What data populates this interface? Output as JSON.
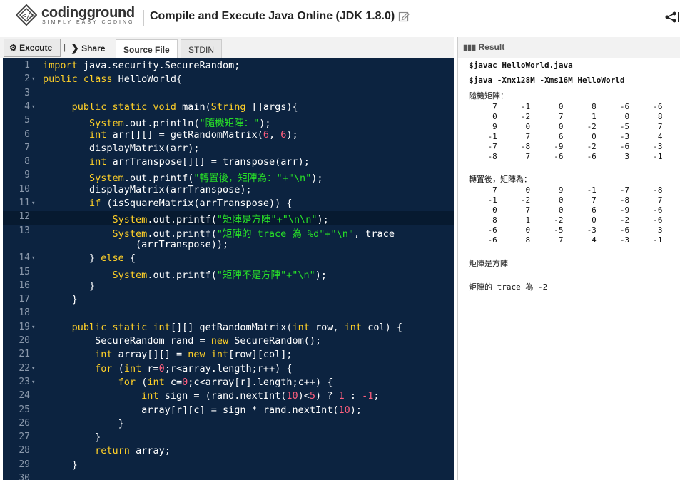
{
  "header": {
    "brand": "codingground",
    "brand_sub": "SIMPLY EASY CODING",
    "title": "Compile and Execute Java Online (JDK 1.8.0)"
  },
  "toolbar": {
    "execute_label": "Execute",
    "share_label": "Share",
    "tabs": [
      "Source File",
      "STDIN"
    ]
  },
  "editor": {
    "lines": [
      {
        "n": "1",
        "fold": false,
        "html": "<span class='k'>import</span> java.security.SecureRandom;"
      },
      {
        "n": "2",
        "fold": true,
        "html": "<span class='k'>public class</span> HelloWorld{"
      },
      {
        "n": "3",
        "fold": false,
        "html": ""
      },
      {
        "n": "4",
        "fold": true,
        "html": "     <span class='k'>public static void</span> main(<span class='k'>String</span> []args){"
      },
      {
        "n": "5",
        "fold": false,
        "html": "        <span class='k'>System</span>.out.println(<span class='s'>\"隨機矩陣：\"</span>);"
      },
      {
        "n": "6",
        "fold": false,
        "html": "        <span class='k'>int</span> arr[][] = getRandomMatrix(<span class='n'>6</span>, <span class='n'>6</span>);"
      },
      {
        "n": "7",
        "fold": false,
        "html": "        displayMatrix(arr);"
      },
      {
        "n": "8",
        "fold": false,
        "html": "        <span class='k'>int</span> arrTranspose[][] = transpose(arr);"
      },
      {
        "n": "9",
        "fold": false,
        "html": "        <span class='k'>System</span>.out.printf(<span class='s'>\"轉置後，矩陣為：\"+\"\\n\"</span>);"
      },
      {
        "n": "10",
        "fold": false,
        "html": "        displayMatrix(arrTranspose);"
      },
      {
        "n": "11",
        "fold": true,
        "html": "        <span class='k'>if</span> (isSquareMatrix(arrTranspose)) {"
      },
      {
        "n": "12",
        "fold": false,
        "html": "            <span class='k'>System</span>.out.printf(<span class='s'>\"矩陣是方陣\"+\"\\n\\n\"</span>);"
      },
      {
        "n": "13",
        "fold": false,
        "html": "            <span class='k'>System</span>.out.printf(<span class='s'>\"矩陣的 trace 為 %d\"+\"\\n\"</span>, trace"
      },
      {
        "n": "",
        "fold": false,
        "html": "                (arrTranspose));"
      },
      {
        "n": "14",
        "fold": true,
        "html": "        } <span class='k'>else</span> {"
      },
      {
        "n": "15",
        "fold": false,
        "html": "            <span class='k'>System</span>.out.printf(<span class='s'>\"矩陣不是方陣\"+\"\\n\"</span>);"
      },
      {
        "n": "16",
        "fold": false,
        "html": "        }"
      },
      {
        "n": "17",
        "fold": false,
        "html": "     }"
      },
      {
        "n": "18",
        "fold": false,
        "html": ""
      },
      {
        "n": "19",
        "fold": true,
        "html": "     <span class='k'>public static int</span>[][] getRandomMatrix(<span class='k'>int</span> row, <span class='k'>int</span> col) {"
      },
      {
        "n": "20",
        "fold": false,
        "html": "         SecureRandom rand = <span class='k'>new</span> SecureRandom();"
      },
      {
        "n": "21",
        "fold": false,
        "html": "         <span class='k'>int</span> array[][] = <span class='k'>new int</span>[row][col];"
      },
      {
        "n": "22",
        "fold": true,
        "html": "         <span class='k'>for</span> (<span class='k'>int</span> r=<span class='n'>0</span>;r&lt;array.length;r++) {"
      },
      {
        "n": "23",
        "fold": true,
        "html": "             <span class='k'>for</span> (<span class='k'>int</span> c=<span class='n'>0</span>;c&lt;array[r].length;c++) {"
      },
      {
        "n": "24",
        "fold": false,
        "html": "                 <span class='k'>int</span> sign = (rand.nextInt(<span class='n'>10</span>)&lt;<span class='n'>5</span>) ? <span class='n'>1</span> : <span class='n'>-1</span>;"
      },
      {
        "n": "25",
        "fold": false,
        "html": "                 array[r][c] = sign * rand.nextInt(<span class='n'>10</span>);"
      },
      {
        "n": "26",
        "fold": false,
        "html": "             }"
      },
      {
        "n": "27",
        "fold": false,
        "html": "         }"
      },
      {
        "n": "28",
        "fold": false,
        "html": "         <span class='k'>return</span> array;"
      },
      {
        "n": "29",
        "fold": false,
        "html": "     }"
      },
      {
        "n": "30",
        "fold": false,
        "html": ""
      }
    ]
  },
  "result": {
    "label": "Result",
    "cmd1": "$javac HelloWorld.java",
    "cmd2": "$java -Xmx128M -Xms16M HelloWorld",
    "random_label": "隨機矩陣：",
    "random_rows": [
      "     7     -1      0      8     -6     -6",
      "     0     -2      7      1      0      8",
      "     9      0      0     -2     -5      7",
      "    -1      7      6      0     -3      4",
      "    -7     -8     -9     -2     -6     -3",
      "    -8      7     -6     -6      3     -1"
    ],
    "transpose_label": "轉置後，矩陣為：",
    "transpose_rows": [
      "     7      0      9     -1     -7     -8",
      "    -1     -2      0      7     -8      7",
      "     0      7      0      6     -9     -6",
      "     8      1     -2      0     -2     -6",
      "    -6      0     -5     -3     -6      3",
      "    -6      8      7      4     -3     -1"
    ],
    "square_msg": "矩陣是方陣",
    "trace_msg": "矩陣的 trace 為 -2"
  }
}
